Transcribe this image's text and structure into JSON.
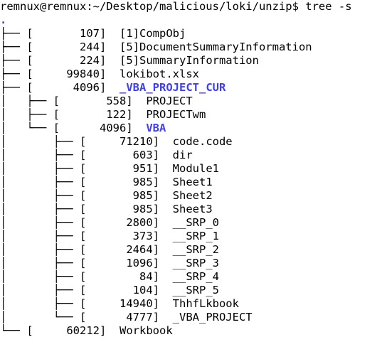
{
  "terminal": {
    "prompt": "remnux@remnux:~/Desktop/malicious/loki/unzip$ tree -s",
    "root": ".",
    "rows": [
      {
        "prefix": "├── [",
        "size": "       107]",
        "name": "[1]CompObj",
        "is_dir": false
      },
      {
        "prefix": "├── [",
        "size": "       244]",
        "name": "[5]DocumentSummaryInformation",
        "is_dir": false
      },
      {
        "prefix": "├── [",
        "size": "       224]",
        "name": "[5]SummaryInformation",
        "is_dir": false
      },
      {
        "prefix": "├── [",
        "size": "     99840]",
        "name": "lokibot.xlsx",
        "is_dir": false
      },
      {
        "prefix": "├── [",
        "size": "      4096]",
        "name": "_VBA_PROJECT_CUR",
        "is_dir": true
      },
      {
        "prefix": "│   ├── [",
        "size": "       558]",
        "name": "PROJECT",
        "is_dir": false
      },
      {
        "prefix": "│   ├── [",
        "size": "       122]",
        "name": "PROJECTwm",
        "is_dir": false
      },
      {
        "prefix": "│   └── [",
        "size": "      4096]",
        "name": "VBA",
        "is_dir": true
      },
      {
        "prefix": "│       ├── [",
        "size": "     71210]",
        "name": "code.code",
        "is_dir": false
      },
      {
        "prefix": "│       ├── [",
        "size": "       603]",
        "name": "dir",
        "is_dir": false
      },
      {
        "prefix": "│       ├── [",
        "size": "       951]",
        "name": "Module1",
        "is_dir": false
      },
      {
        "prefix": "│       ├── [",
        "size": "       985]",
        "name": "Sheet1",
        "is_dir": false
      },
      {
        "prefix": "│       ├── [",
        "size": "       985]",
        "name": "Sheet2",
        "is_dir": false
      },
      {
        "prefix": "│       ├── [",
        "size": "       985]",
        "name": "Sheet3",
        "is_dir": false
      },
      {
        "prefix": "│       ├── [",
        "size": "      2800]",
        "name": "__SRP_0",
        "is_dir": false
      },
      {
        "prefix": "│       ├── [",
        "size": "       373]",
        "name": "__SRP_1",
        "is_dir": false
      },
      {
        "prefix": "│       ├── [",
        "size": "      2464]",
        "name": "__SRP_2",
        "is_dir": false
      },
      {
        "prefix": "│       ├── [",
        "size": "      1096]",
        "name": "__SRP_3",
        "is_dir": false
      },
      {
        "prefix": "│       ├── [",
        "size": "        84]",
        "name": "__SRP_4",
        "is_dir": false
      },
      {
        "prefix": "│       ├── [",
        "size": "       104]",
        "name": "__SRP_5",
        "is_dir": false
      },
      {
        "prefix": "│       ├── [",
        "size": "     14940]",
        "name": "ThhfLkbook",
        "is_dir": false
      },
      {
        "prefix": "│       └── [",
        "size": "      4777]",
        "name": "_VBA_PROJECT",
        "is_dir": false
      },
      {
        "prefix": "└── [",
        "size": "     60212]",
        "name": "Workbook",
        "is_dir": false
      }
    ]
  }
}
